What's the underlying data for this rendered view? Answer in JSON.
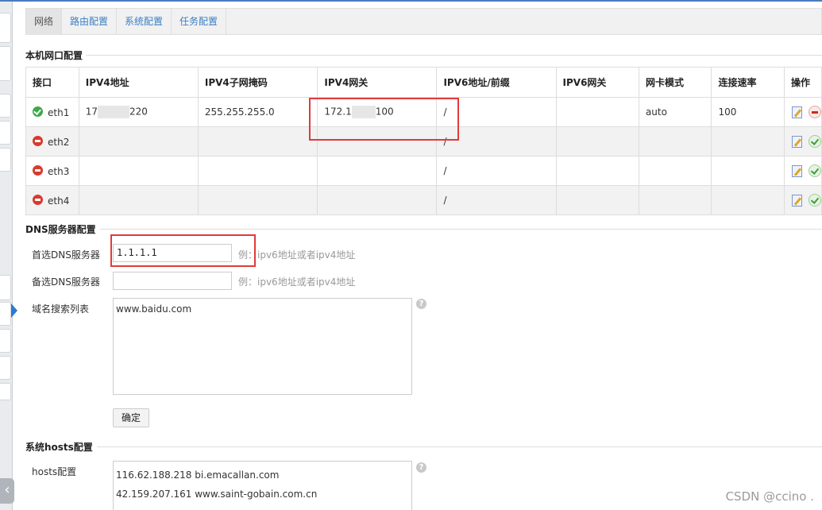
{
  "tabs": [
    "网络",
    "路由配置",
    "系统配置",
    "任务配置"
  ],
  "sections": {
    "nic": "本机网口配置",
    "dns": "DNS服务器配置",
    "hosts": "系统hosts配置"
  },
  "nic_table": {
    "headers": [
      "接口",
      "IPV4地址",
      "IPV4子网掩码",
      "IPV4网关",
      "IPV6地址/前缀",
      "IPV6网关",
      "网卡模式",
      "连接速率",
      "操作"
    ],
    "rows": [
      {
        "status": "up",
        "iface": "eth1",
        "ipv4_prefix": "17",
        "ipv4_suffix": "220",
        "mask": "255.255.255.0",
        "gw_prefix": "172.1",
        "gw_suffix": "100",
        "ipv6": "/",
        "ipv6gw": "",
        "mode": "auto",
        "speed": "100"
      },
      {
        "status": "down",
        "iface": "eth2",
        "ipv4_prefix": "",
        "ipv4_suffix": "",
        "mask": "",
        "gw_prefix": "",
        "gw_suffix": "",
        "ipv6": "/",
        "ipv6gw": "",
        "mode": "",
        "speed": ""
      },
      {
        "status": "down",
        "iface": "eth3",
        "ipv4_prefix": "",
        "ipv4_suffix": "",
        "mask": "",
        "gw_prefix": "",
        "gw_suffix": "",
        "ipv6": "/",
        "ipv6gw": "",
        "mode": "",
        "speed": ""
      },
      {
        "status": "down",
        "iface": "eth4",
        "ipv4_prefix": "",
        "ipv4_suffix": "",
        "mask": "",
        "gw_prefix": "",
        "gw_suffix": "",
        "ipv6": "/",
        "ipv6gw": "",
        "mode": "",
        "speed": ""
      }
    ]
  },
  "dns": {
    "primary_label": "首选DNS服务器",
    "primary_value": "1.1.1.1",
    "primary_hint": "例：ipv6地址或者ipv4地址",
    "secondary_label": "备选DNS服务器",
    "secondary_value": "",
    "secondary_hint": "例：ipv6地址或者ipv4地址",
    "search_label": "域名搜索列表",
    "search_value": "www.baidu.com",
    "confirm_label": "确定"
  },
  "hosts": {
    "label": "hosts配置",
    "lines": [
      "116.62.188.218 bi.emacallan.com",
      "42.159.207.161 www.saint-gobain.com.cn"
    ]
  },
  "watermark": "CSDN @ccino ."
}
